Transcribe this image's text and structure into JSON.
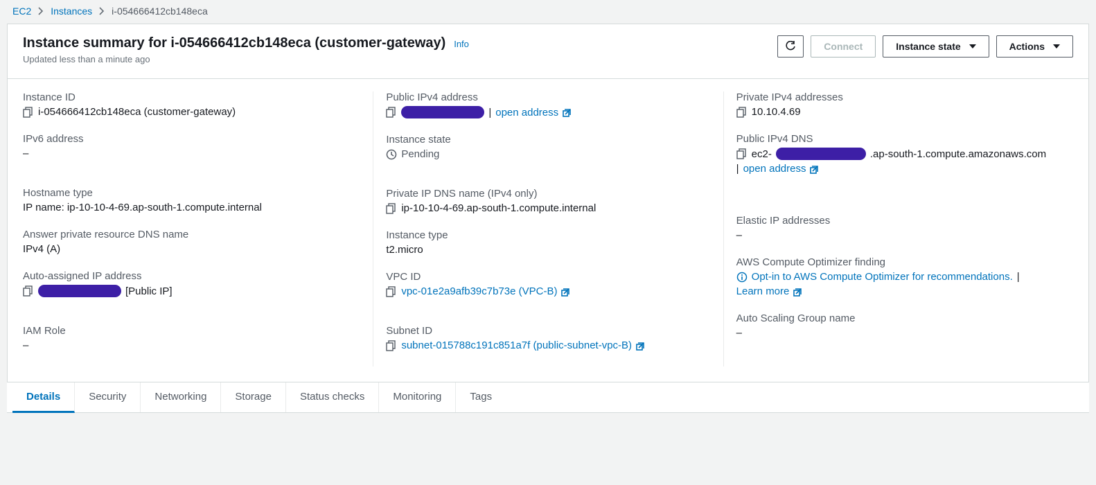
{
  "breadcrumb": {
    "root": "EC2",
    "instances": "Instances",
    "current": "i-054666412cb148eca"
  },
  "header": {
    "title": "Instance summary for i-054666412cb148eca (customer-gateway)",
    "info": "Info",
    "subtitle": "Updated less than a minute ago"
  },
  "actions": {
    "connect": "Connect",
    "instance_state": "Instance state",
    "actions": "Actions"
  },
  "col1": {
    "instance_id_label": "Instance ID",
    "instance_id_value": "i-054666412cb148eca (customer-gateway)",
    "ipv6_label": "IPv6 address",
    "ipv6_value": "–",
    "hostname_type_label": "Hostname type",
    "hostname_type_value": "IP name: ip-10-10-4-69.ap-south-1.compute.internal",
    "answer_dns_label": "Answer private resource DNS name",
    "answer_dns_value": "IPv4 (A)",
    "auto_ip_label": "Auto-assigned IP address",
    "auto_ip_suffix": "[Public IP]",
    "iam_label": "IAM Role",
    "iam_value": "–"
  },
  "col2": {
    "public_ipv4_label": "Public IPv4 address",
    "open_address": "open address",
    "instance_state_label": "Instance state",
    "instance_state_value": "Pending",
    "private_dns_label": "Private IP DNS name (IPv4 only)",
    "private_dns_value": "ip-10-10-4-69.ap-south-1.compute.internal",
    "instance_type_label": "Instance type",
    "instance_type_value": "t2.micro",
    "vpc_label": "VPC ID",
    "vpc_value": "vpc-01e2a9afb39c7b73e (VPC-B)",
    "subnet_label": "Subnet ID",
    "subnet_value": "subnet-015788c191c851a7f (public-subnet-vpc-B)"
  },
  "col3": {
    "private_ipv4_label": "Private IPv4 addresses",
    "private_ipv4_value": "10.10.4.69",
    "public_dns_label": "Public IPv4 DNS",
    "public_dns_prefix": "ec2-",
    "public_dns_suffix": ".ap-south-1.compute.amazonaws.com",
    "open_address": "open address",
    "elastic_ip_label": "Elastic IP addresses",
    "elastic_ip_value": "–",
    "optimizer_label": "AWS Compute Optimizer finding",
    "optimizer_text": "Opt-in to AWS Compute Optimizer for recommendations.",
    "learn_more": "Learn more",
    "asg_label": "Auto Scaling Group name",
    "asg_value": "–"
  },
  "tabs": {
    "details": "Details",
    "security": "Security",
    "networking": "Networking",
    "storage": "Storage",
    "status": "Status checks",
    "monitoring": "Monitoring",
    "tags": "Tags"
  }
}
